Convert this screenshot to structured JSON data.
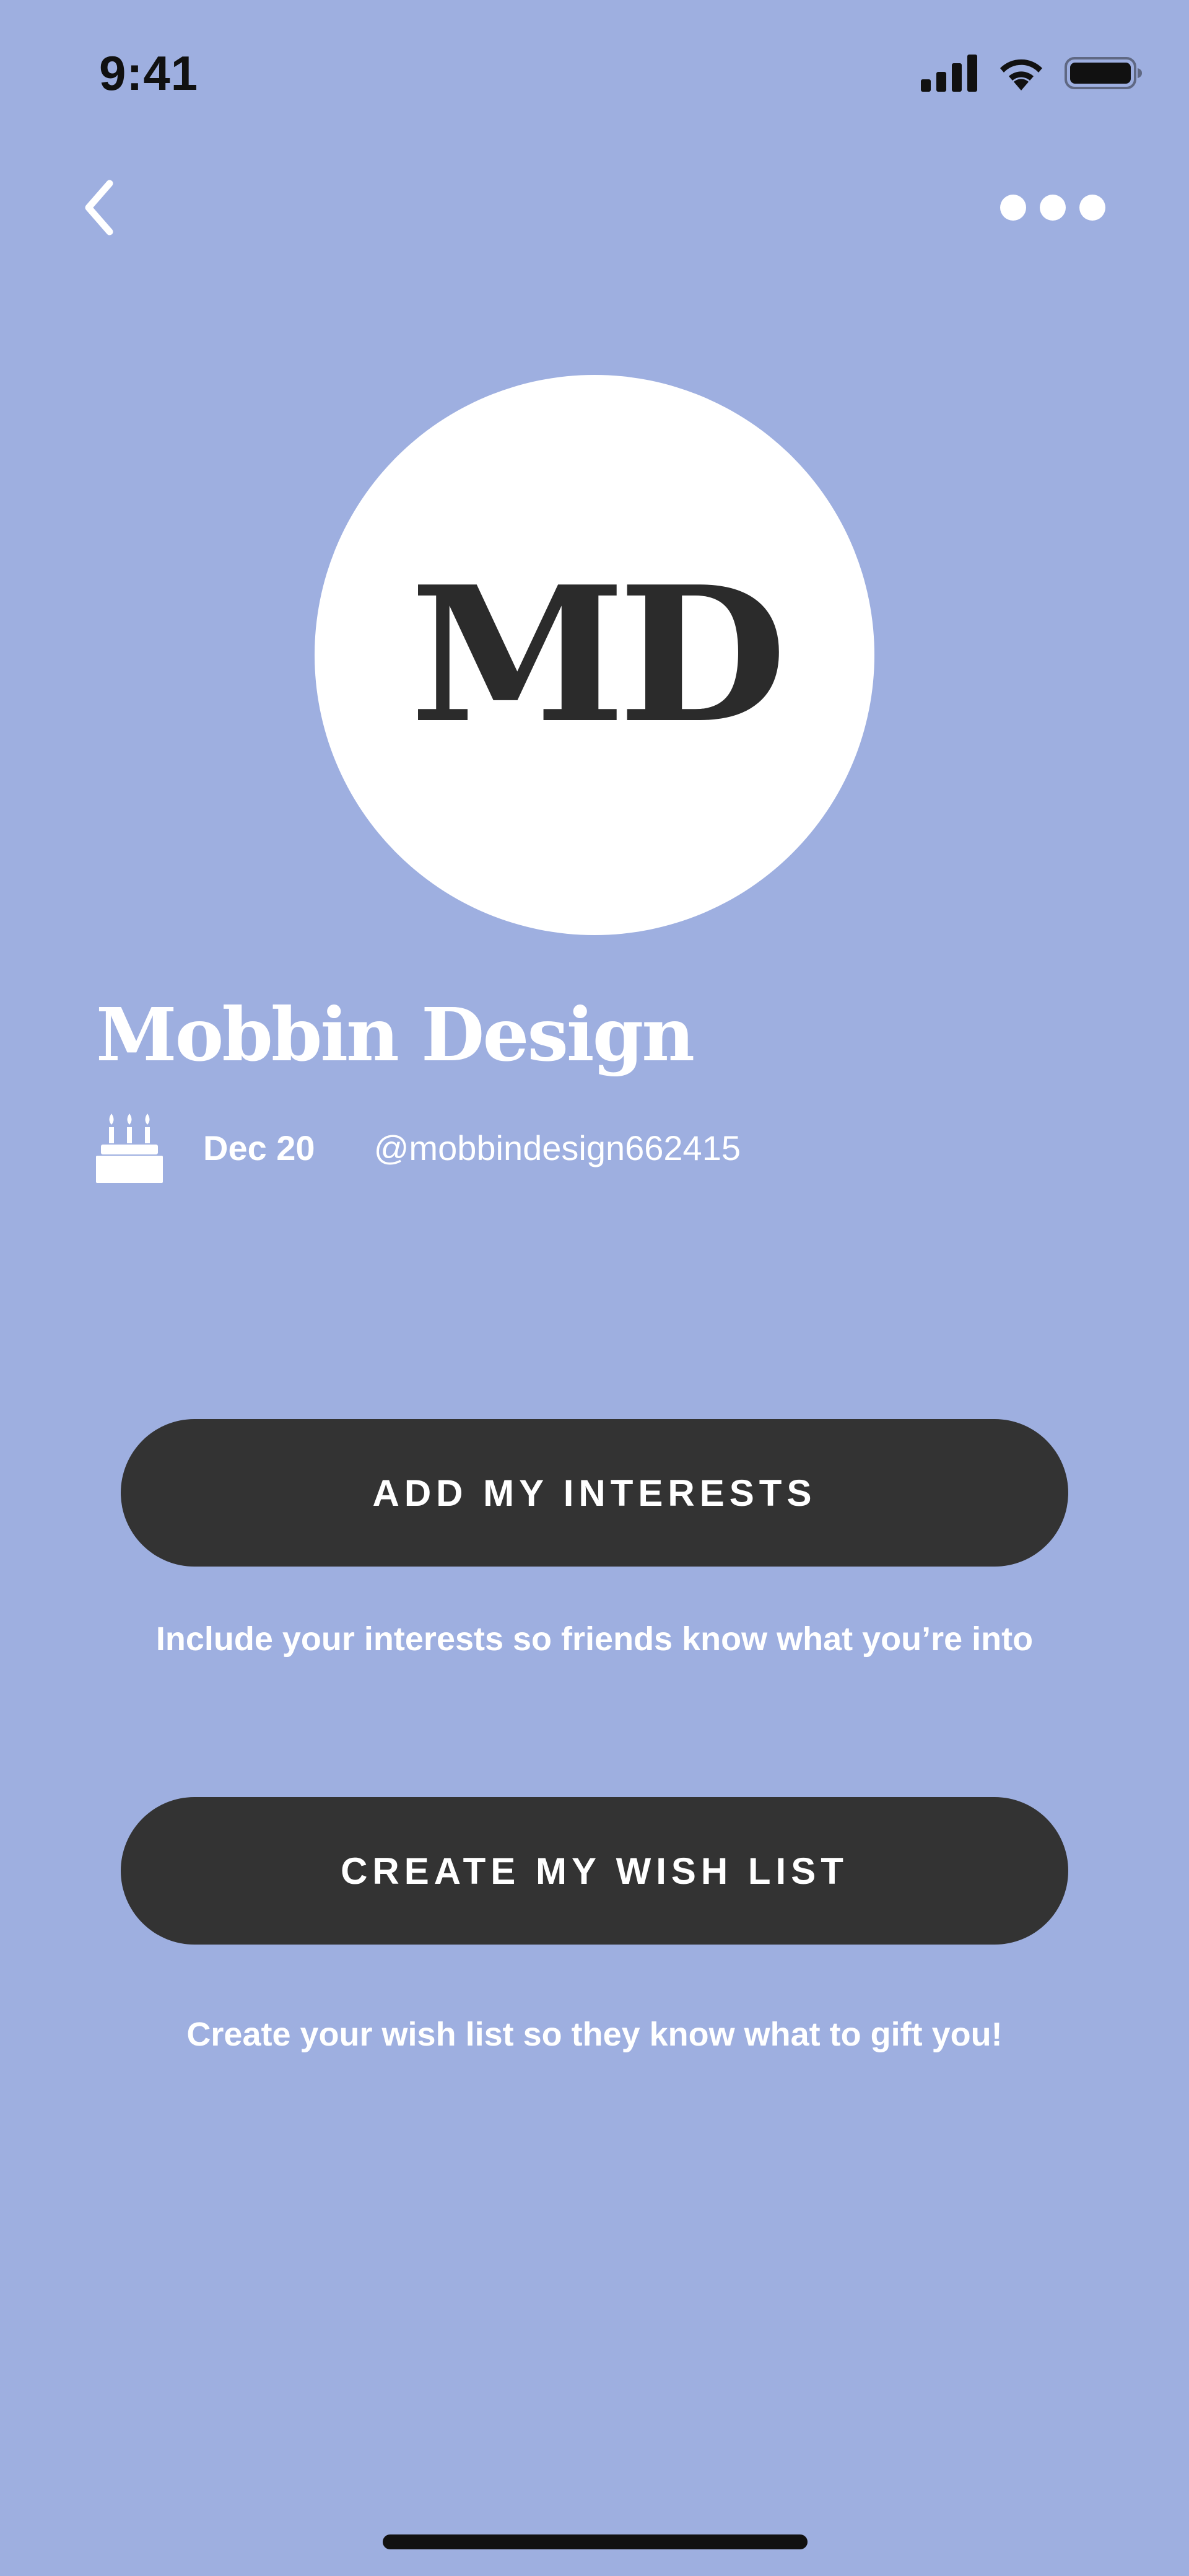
{
  "status_bar": {
    "time": "9:41",
    "icons": [
      "cellular-signal-icon",
      "wifi-icon",
      "battery-icon"
    ]
  },
  "nav": {
    "back_icon": "chevron-left-icon",
    "more_icon": "more-horizontal-icon"
  },
  "profile": {
    "initials": "MD",
    "name": "Mobbin Design",
    "birthday_icon": "birthday-cake-icon",
    "birthday": "Dec 20",
    "handle": "@mobbindesign662415"
  },
  "actions": {
    "interests": {
      "label": "ADD MY INTERESTS",
      "helper": "Include your interests so friends know what you’re into"
    },
    "wishlist": {
      "label": "CREATE MY WISH LIST",
      "helper": "Create your wish list so they know what to gift you!"
    }
  },
  "colors": {
    "background": "#9EAFE0",
    "button": "#333333",
    "avatar_bg": "#FFFFFF",
    "avatar_text": "#2B2B2B",
    "text": "#FFFFFF"
  }
}
